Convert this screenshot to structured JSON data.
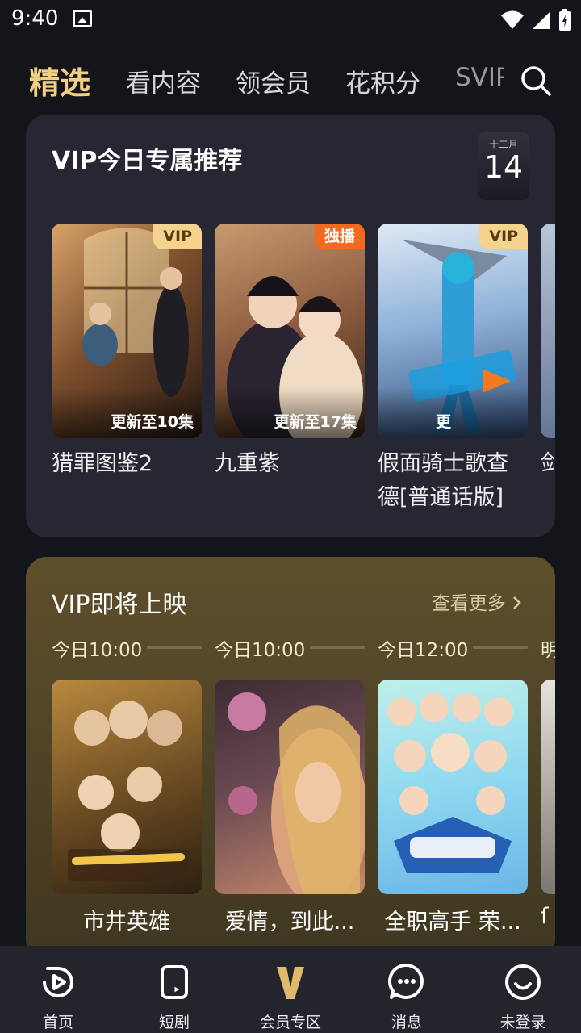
{
  "status_bar": {
    "time": "9:40"
  },
  "top_nav": {
    "tabs": [
      {
        "label": "精选",
        "active": true
      },
      {
        "label": "看内容",
        "active": false
      },
      {
        "label": "领会员",
        "active": false
      },
      {
        "label": "花积分",
        "active": false
      },
      {
        "label": "SVIP",
        "active": false
      }
    ]
  },
  "recommend": {
    "title": "VIP今日专属推荐",
    "date": {
      "month": "十二月",
      "day": "14"
    },
    "items": [
      {
        "title": "猎罪图鉴2",
        "badge": "VIP",
        "update": "更新至10集"
      },
      {
        "title": "九重紫",
        "badge": "独播",
        "update": "更新至17集"
      },
      {
        "title": "假面骑士歌查德[普通话版]",
        "badge": "VIP",
        "update": "更"
      },
      {
        "title": "剑"
      }
    ]
  },
  "upcoming": {
    "title": "VIP即将上映",
    "more": "查看更多",
    "items": [
      {
        "time": "今日10:00",
        "title": "市井英雄"
      },
      {
        "time": "今日10:00",
        "title": "爱情，到此..."
      },
      {
        "time": "今日12:00",
        "title": "全职高手 荣..."
      },
      {
        "time": "明",
        "title": "ſ"
      }
    ]
  },
  "bottom_nav": {
    "items": [
      {
        "label": "首页",
        "icon": "play-icon"
      },
      {
        "label": "短剧",
        "icon": "short-drama-icon"
      },
      {
        "label": "会员专区",
        "icon": "vip-v-icon"
      },
      {
        "label": "消息",
        "icon": "message-icon"
      },
      {
        "label": "未登录",
        "icon": "profile-icon"
      }
    ]
  },
  "colors": {
    "accent": "#f1cf83",
    "background": "#14151b",
    "card": "#262732",
    "upcoming_card": "#5e4f2c"
  }
}
